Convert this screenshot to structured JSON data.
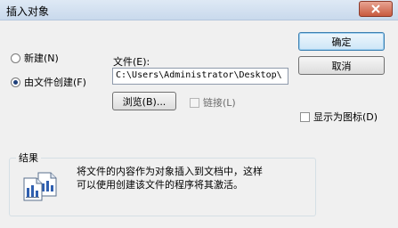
{
  "window": {
    "title": "插入对象"
  },
  "options": {
    "create_new_label": "新建(N)",
    "create_from_file_label": "由文件创建(F)"
  },
  "file": {
    "label": "文件(E):",
    "path": "C:\\Users\\Administrator\\Desktop\\"
  },
  "buttons": {
    "ok": "确定",
    "cancel": "取消",
    "browse": "浏览(B)...",
    "link": "链接(L)",
    "display_as_icon": "显示为图标(D)"
  },
  "result": {
    "title": "结果",
    "text_line1": "将文件的内容作为对象插入到文档中，这样",
    "text_line2": "可以使用创建该文件的程序将其激活。"
  }
}
